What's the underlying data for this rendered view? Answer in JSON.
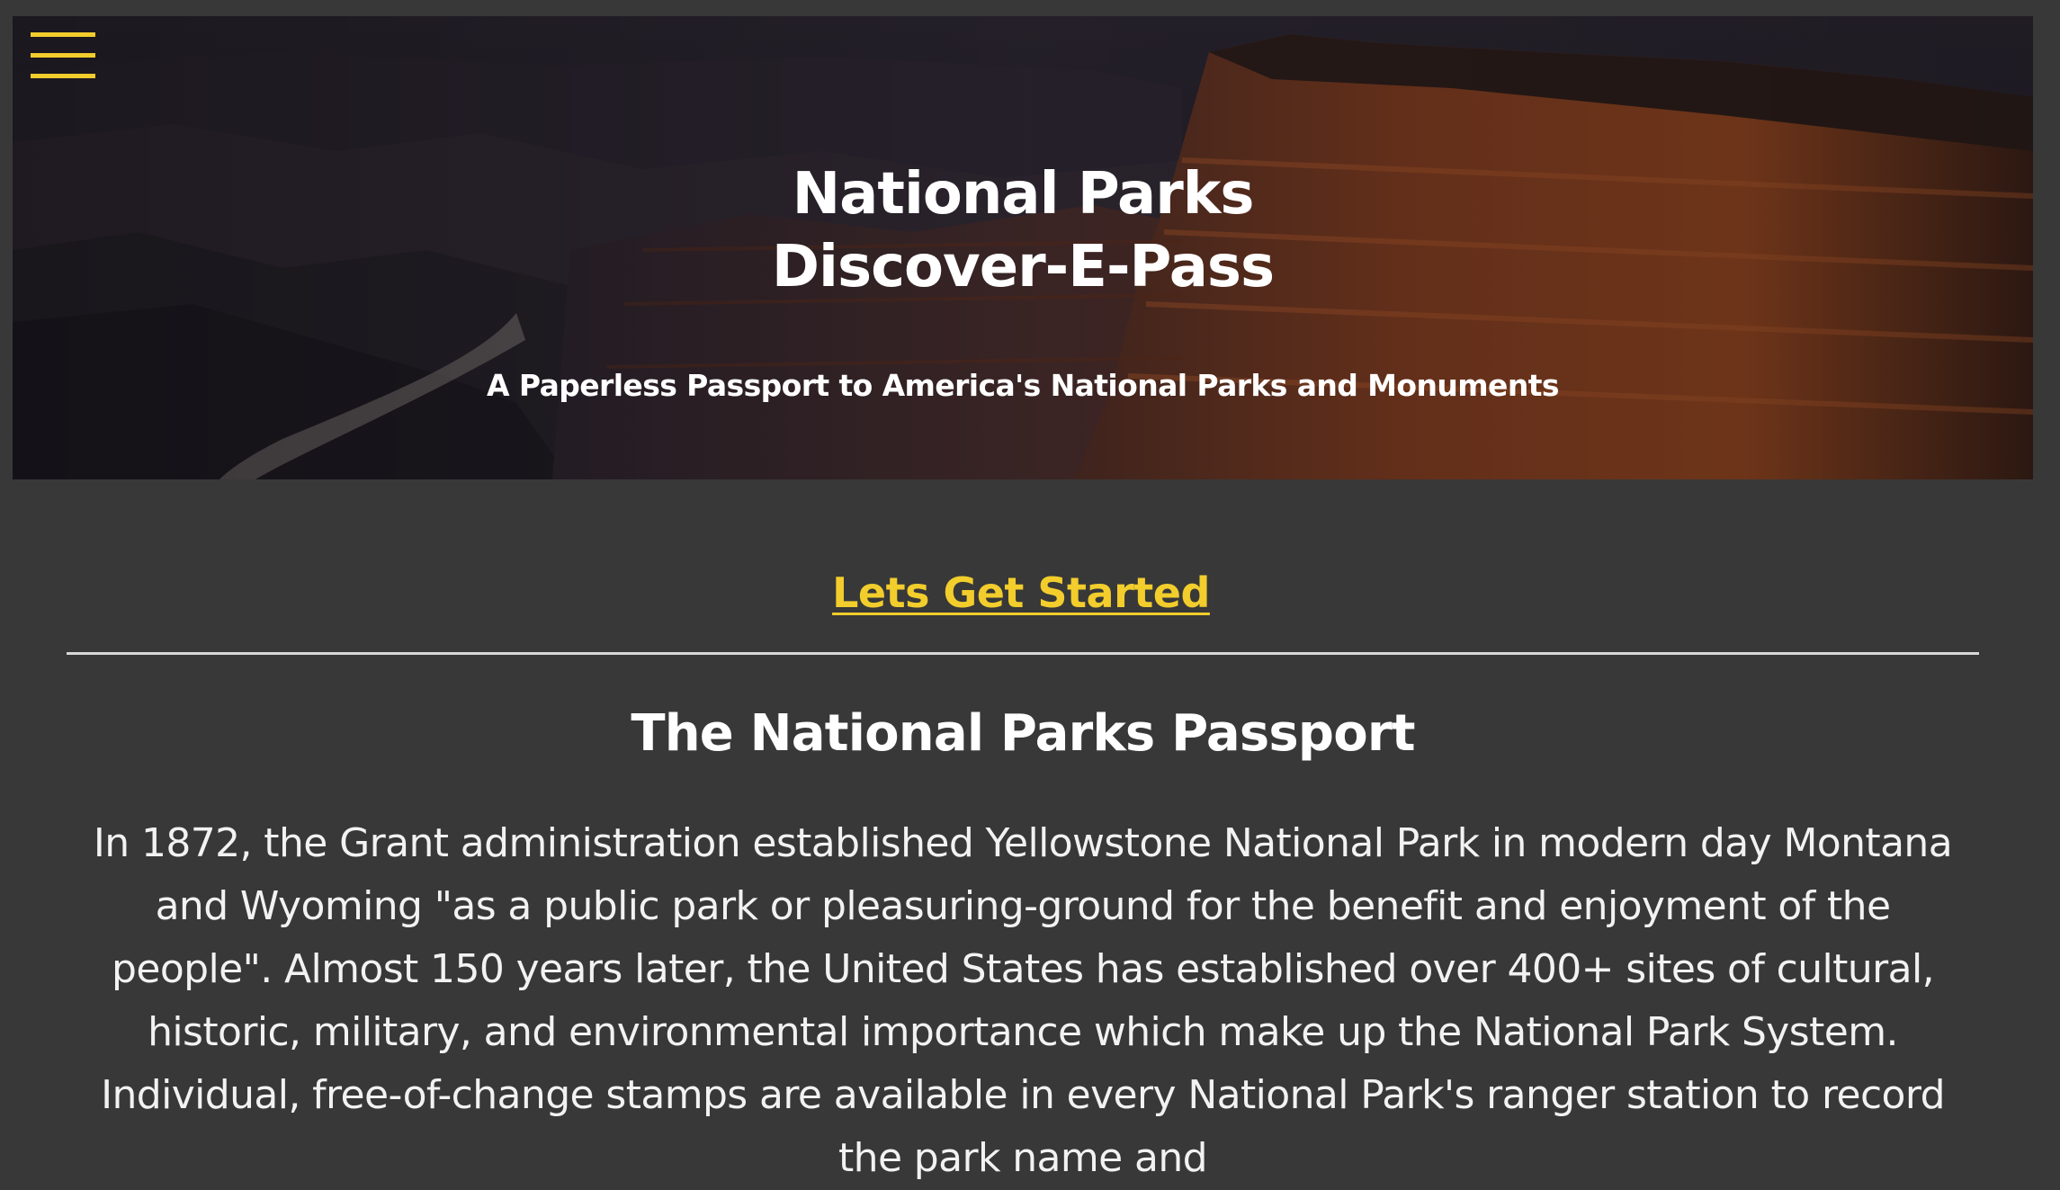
{
  "header": {
    "menu_icon": "hamburger-menu-icon",
    "title_line1": "National Parks",
    "title_line2": "Discover-E-Pass",
    "subtitle": "A Paperless Passport to America's National Parks and Monuments",
    "hero_image": "canyon-landscape"
  },
  "cta": {
    "label": "Lets Get Started"
  },
  "passport_section": {
    "title": "The National Parks Passport",
    "body": "In 1872, the Grant administration established Yellowstone National Park in modern day Montana and Wyoming \"as a public park or pleasuring-ground for the benefit and enjoyment of the people\". Almost 150 years later, the United States has established over 400+ sites of cultural, historic, military, and environmental importance which make up the National Park System. Individual, free-of-change stamps are available in every National Park's ranger station to record the park name and"
  },
  "colors": {
    "background": "#383838",
    "accent": "#f2cd2c",
    "text": "#ffffff"
  }
}
